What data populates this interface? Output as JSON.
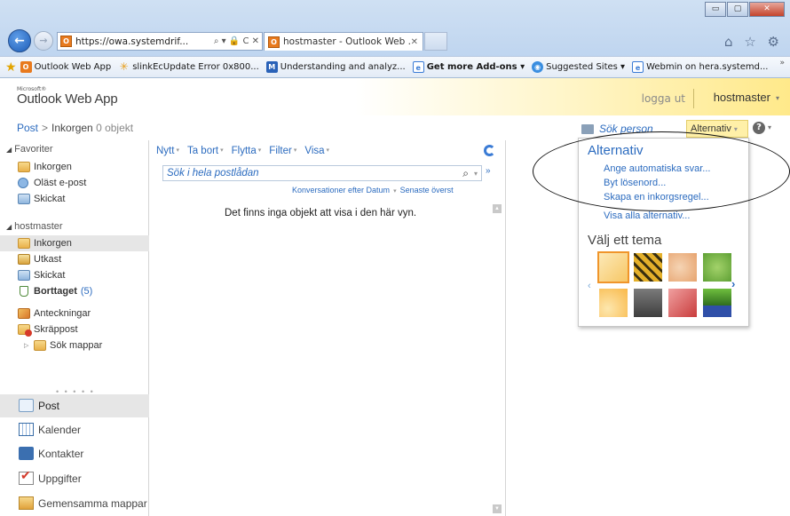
{
  "browser": {
    "address_url": "https://owa.systemdrif...",
    "address_tools": "⌕ ▾ 🔒 C ✕",
    "tab_title": "hostmaster - Outlook Web ...",
    "tab_close": "✕",
    "right_icons": "⌂ ☆ ⚙",
    "window_min": "▭",
    "window_max": "▢",
    "window_close": "✕",
    "favorites": [
      {
        "label": "Outlook Web App",
        "icon": "owa-icon",
        "glyph": "O"
      },
      {
        "label": "slinkEcUpdate Error 0x800...",
        "icon": "warning-icon",
        "glyph": "✳"
      },
      {
        "label": "Understanding and analyz...",
        "icon": "m-icon",
        "glyph": "M"
      },
      {
        "label": "Get more Add-ons ▾",
        "icon": "ie-icon",
        "glyph": "e"
      },
      {
        "label": "Suggested Sites ▾",
        "icon": "suggested-sites-icon",
        "glyph": "◉"
      },
      {
        "label": "Webmin on hera.systemd...",
        "icon": "ie-icon",
        "glyph": "e"
      }
    ],
    "favbar_more": "»"
  },
  "owa": {
    "ms_label": "Microsoft®",
    "app_title": "Outlook Web App",
    "logout": "logga ut",
    "user": "hostmaster",
    "user_arrow": "▾"
  },
  "breadcrumb": {
    "root": "Post",
    "sep": ">",
    "folder": "Inkorgen",
    "count": "0 objekt"
  },
  "findperson": "Sök person",
  "options_button": {
    "label": "Alternativ",
    "arrow": "▾"
  },
  "help": {
    "icon": "?",
    "arrow": "▾"
  },
  "nav": {
    "favorites_head": "Favoriter",
    "favorites": [
      {
        "label": "Inkorgen",
        "icon": "inbox-folder-icon"
      },
      {
        "label": "Oläst e-post",
        "icon": "unread-mail-icon"
      },
      {
        "label": "Skickat",
        "icon": "sent-folder-icon"
      }
    ],
    "mailbox_head": "hostmaster",
    "mailbox": [
      {
        "label": "Inkorgen",
        "icon": "inbox-folder-icon"
      },
      {
        "label": "Utkast",
        "icon": "drafts-folder-icon"
      },
      {
        "label": "Skickat",
        "icon": "sent-folder-icon"
      },
      {
        "label": "Borttaget",
        "count": "(5)",
        "icon": "deleted-folder-icon"
      },
      {
        "label": "Anteckningar",
        "icon": "notes-folder-icon"
      },
      {
        "label": "Skräppost",
        "icon": "junk-folder-icon"
      },
      {
        "label": "Sök mappar",
        "icon": "search-folder-icon"
      }
    ],
    "dots": "• • • • •",
    "modules": [
      {
        "label": "Post",
        "icon": "mail-icon"
      },
      {
        "label": "Kalender",
        "icon": "calendar-icon"
      },
      {
        "label": "Kontakter",
        "icon": "contacts-icon"
      },
      {
        "label": "Uppgifter",
        "icon": "tasks-icon"
      },
      {
        "label": "Gemensamma mappar",
        "icon": "public-folders-icon"
      }
    ]
  },
  "list": {
    "toolbar": [
      "Nytt",
      "Ta bort",
      "Flytta",
      "Filter",
      "Visa"
    ],
    "search_placeholder": "Sök i hela postlådan",
    "sort_by": "Konversationer efter Datum",
    "sort_order": "Senaste överst",
    "empty_message": "Det finns inga objekt att visa i den här vyn."
  },
  "options_menu": {
    "header": "Alternativ",
    "links": [
      "Ange automatiska svar...",
      "Byt lösenord...",
      "Skapa en inkorgsregel...",
      "Visa alla alternativ..."
    ],
    "theme_header": "Välj ett tema",
    "themes": [
      "theme-1",
      "theme-2",
      "theme-3",
      "theme-4",
      "theme-5",
      "theme-6",
      "theme-7",
      "theme-8"
    ],
    "selected_theme": "theme-1"
  }
}
